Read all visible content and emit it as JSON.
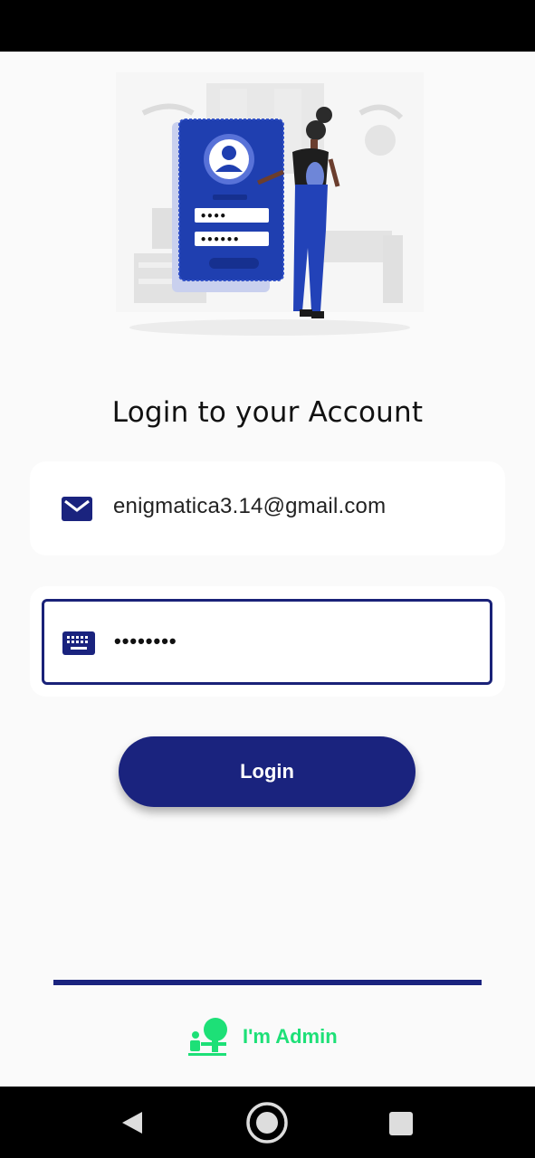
{
  "login": {
    "title": "Login to your Account",
    "email_value": "enigmatica3.14@gmail.com",
    "password_value": "••••••••",
    "login_label": "Login"
  },
  "illustration": {
    "field_1_mask": "••••",
    "field_2_mask": "••••••"
  },
  "admin": {
    "label": "I'm Admin"
  },
  "icons": {
    "email": "email-icon",
    "password": "keyboard-icon",
    "admin": "admin-icon",
    "nav_back": "back-triangle-icon",
    "nav_home": "home-circle-icon",
    "nav_recent": "recents-square-icon"
  },
  "colors": {
    "primary": "#1a237e",
    "admin_accent": "#1de077",
    "background": "#fafafa"
  }
}
